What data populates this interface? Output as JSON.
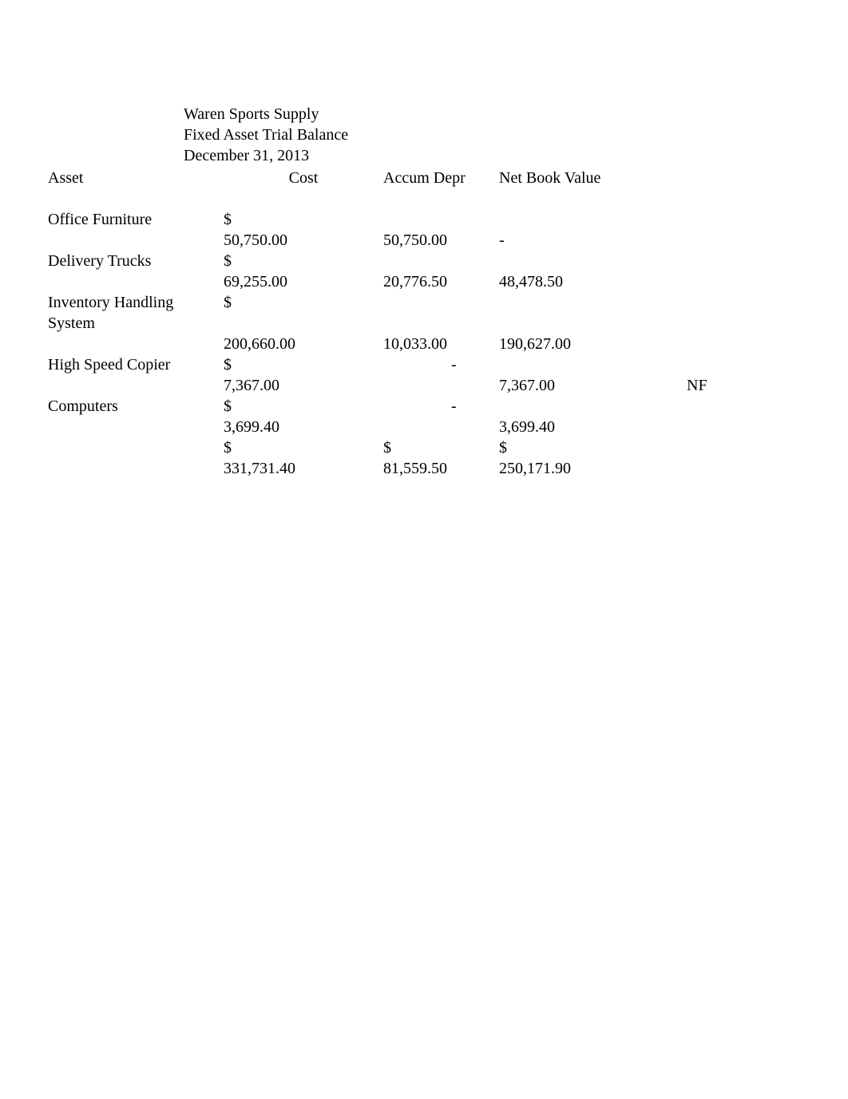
{
  "header": {
    "company": "Waren Sports Supply",
    "report_title": "Fixed Asset Trial Balance",
    "date": "December 31, 2013"
  },
  "columns": {
    "asset": "Asset",
    "cost": "Cost",
    "accum": "Accum Depr",
    "nbv": "Net Book Value"
  },
  "rows": [
    {
      "asset": "Office Furniture",
      "cost_sym": "$",
      "cost_val": "50,750.00",
      "accum": "50,750.00",
      "nbv": "-",
      "note": ""
    },
    {
      "asset": "Delivery Trucks",
      "cost_sym": "$",
      "cost_val": "69,255.00",
      "accum": "20,776.50",
      "nbv": "48,478.50",
      "note": ""
    },
    {
      "asset": "Inventory Handling System",
      "cost_sym": "$",
      "cost_val": "200,660.00",
      "accum": "10,033.00",
      "nbv": "190,627.00",
      "note": ""
    },
    {
      "asset": "High Speed Copier",
      "cost_sym": "$",
      "cost_val": "7,367.00",
      "accum": "-",
      "nbv": "7,367.00",
      "note": "NF"
    },
    {
      "asset": "Computers",
      "cost_sym": "$",
      "cost_val": "3,699.40",
      "accum": "-",
      "nbv": "3,699.40",
      "note": ""
    }
  ],
  "totals": {
    "cost_sym": "$",
    "cost_val": "331,731.40",
    "accum_sym": "$",
    "accum_val": "81,559.50",
    "nbv_sym": "$",
    "nbv_val": "250,171.90"
  }
}
